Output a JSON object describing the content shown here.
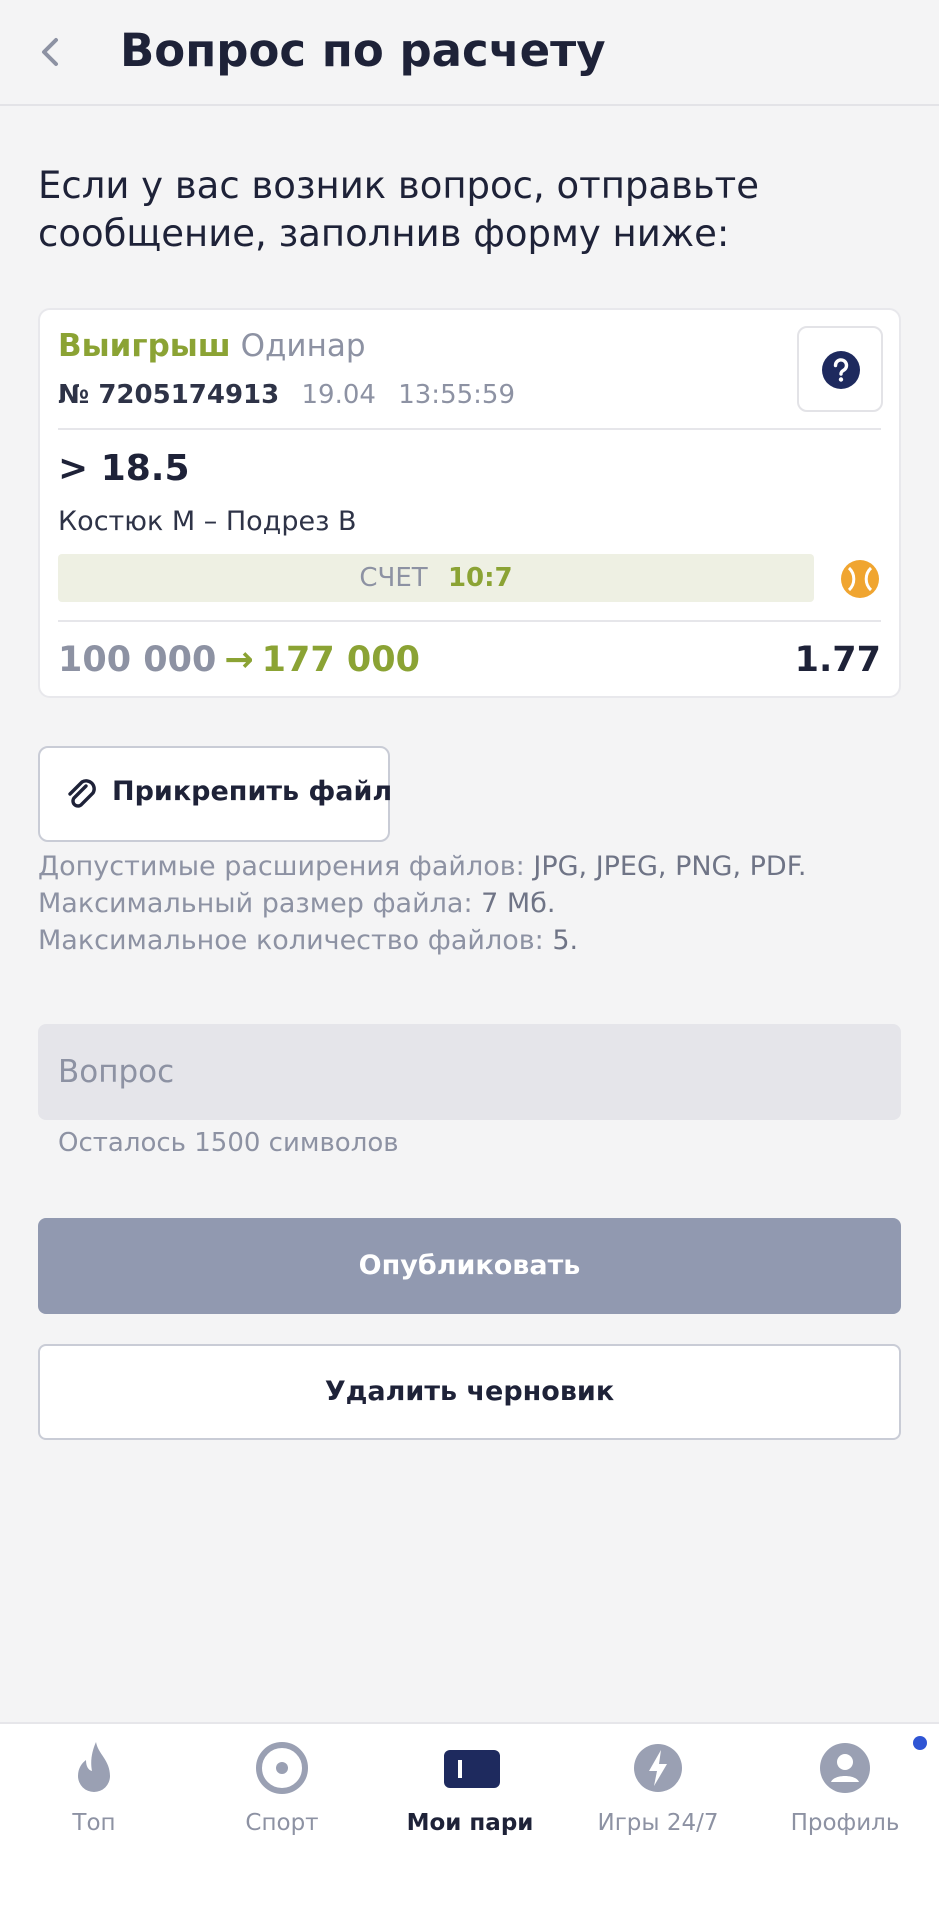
{
  "header": {
    "title": "Вопрос по расчету",
    "back_icon": "chevron-left-icon"
  },
  "intro": "Если у вас возник вопрос, отправьте сообщение, заполнив форму ниже:",
  "bet": {
    "status": "Выигрыш",
    "type": "Одинар",
    "number": "№ 7205174913",
    "date": "19.04",
    "time": "13:55:59",
    "outcome": "> 18.5",
    "match": "Костюк М – Подрез В",
    "score_label": "СЧЕТ",
    "score_value": "10:7",
    "stake": "100 000",
    "arrow": "→",
    "payout": "177 000",
    "odds": "1.77",
    "help_icon": "question-circle-icon",
    "sport_icon": "tennis-ball-icon"
  },
  "attach": {
    "label": "Прикрепить файл",
    "icon": "paperclip-icon"
  },
  "rules": {
    "ext_label": "Допустимые расширения файлов:",
    "ext_value": "JPG, JPEG, PNG, PDF.",
    "size_label": "Максимальный размер файла:",
    "size_value": "7 Мб.",
    "count_label": "Максимальное количество файлов:",
    "count_value": "5."
  },
  "question": {
    "placeholder": "Вопрос",
    "value": "",
    "counter": "Осталось 1500 символов"
  },
  "buttons": {
    "publish": "Опубликовать",
    "delete_draft": "Удалить черновик"
  },
  "tabs": [
    {
      "label": "Топ",
      "icon": "flame-icon"
    },
    {
      "label": "Спорт",
      "icon": "target-icon"
    },
    {
      "label": "Мои пари",
      "icon": "ticket-icon",
      "active": true
    },
    {
      "label": "Игры 24/7",
      "icon": "lightning-icon"
    },
    {
      "label": "Профиль",
      "icon": "user-icon",
      "notification": true
    }
  ],
  "colors": {
    "accent_green": "#8ba334",
    "dark": "#1e2238",
    "muted": "#8d92a3",
    "publish_bg": "#9199b0",
    "live_orange": "#f0a530",
    "notif_blue": "#2f55d4"
  }
}
